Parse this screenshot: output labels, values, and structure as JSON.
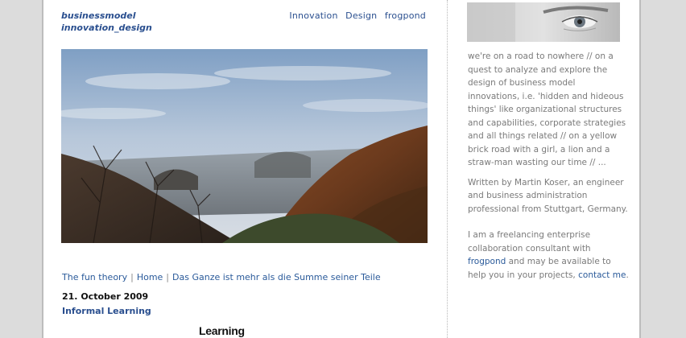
{
  "header": {
    "title_line1": "businessmodel",
    "title_line2": "innovation_design",
    "nav": [
      "Innovation",
      "Design",
      "frogpond"
    ]
  },
  "post_nav": {
    "prev": "The fun theory",
    "separator": "|",
    "home": "Home",
    "next": "Das Ganze ist mehr als die Summe seiner Teile"
  },
  "post": {
    "date": "21. October 2009",
    "title": "Informal Learning",
    "image_caption": "Learning"
  },
  "sidebar": {
    "intro": "we're on a road to nowhere // on a quest to analyze and explore the design of business model innovations, i.e. 'hidden and hideous things' like organizational structures and capabilities, corporate strategies and all things related // on a yellow brick road with a girl, a lion and a straw-man wasting our time // ...",
    "author": "Written by Martin Koser, an engineer and business administration professional from Stuttgart, Germany.",
    "freelance_pre": "I am a freelancing enterprise collaboration consultant with",
    "freelance_link": "frogpond",
    "freelance_mid": "and may be available to help you in your projects,",
    "contact_link": "contact me",
    "freelance_end": "."
  }
}
